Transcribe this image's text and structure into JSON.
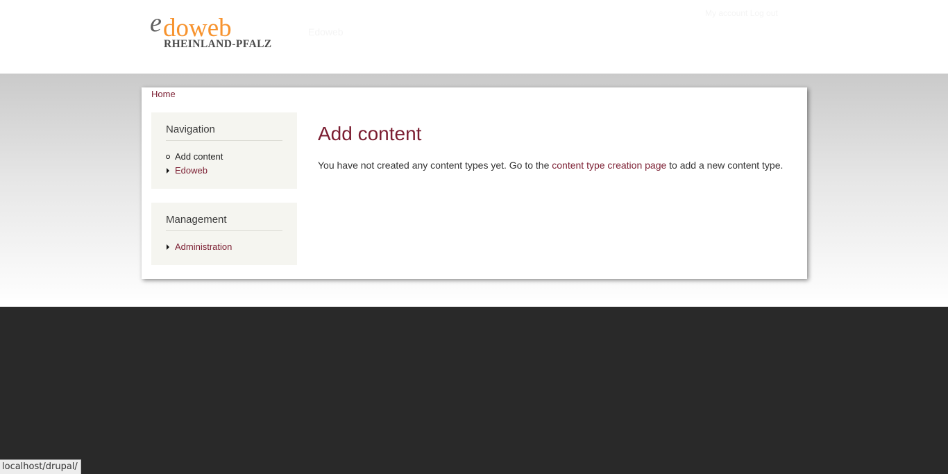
{
  "header": {
    "logo": {
      "e": "e",
      "doweb": "doweb",
      "region": "RHEINLAND-PFALZ"
    },
    "site_name": "Edoweb",
    "secondary_menu": "My account   Log out"
  },
  "breadcrumb": {
    "home": "Home"
  },
  "sidebar": {
    "navigation": {
      "title": "Navigation",
      "items": [
        {
          "label": "Add content",
          "bullet": "circle",
          "active": true
        },
        {
          "label": "Edoweb",
          "bullet": "triangle",
          "active": false
        }
      ]
    },
    "management": {
      "title": "Management",
      "items": [
        {
          "label": "Administration",
          "bullet": "triangle",
          "active": false
        }
      ]
    }
  },
  "main": {
    "title": "Add content",
    "text_before": "You have not created any content types yet. Go to the ",
    "link_text": "content type creation page",
    "text_after": " to add a new content type."
  },
  "status_bar": {
    "url": "localhost/drupal/"
  },
  "colors": {
    "accent": "#7b1d31",
    "logo_orange": "#f7932e",
    "block_bg": "#f5f5f0",
    "footer_bg": "#292929"
  }
}
